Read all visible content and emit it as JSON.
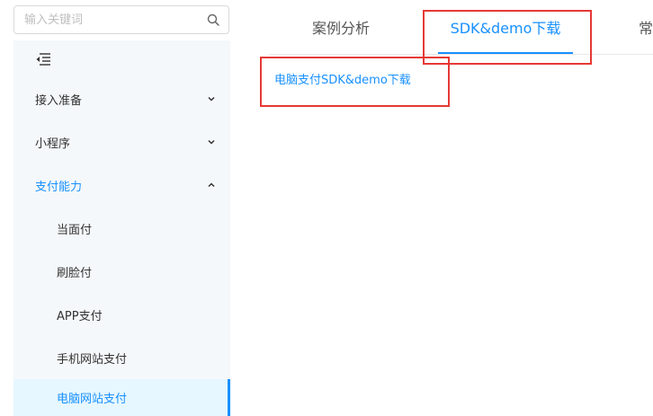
{
  "search": {
    "placeholder": "输入关键词",
    "value": "",
    "icon": "search-icon"
  },
  "sidebar": {
    "collapse_icon": "menu-fold-icon",
    "items": [
      {
        "label": "接入准备",
        "expanded": false
      },
      {
        "label": "小程序",
        "expanded": false
      },
      {
        "label": "支付能力",
        "expanded": true,
        "children": [
          {
            "label": "当面付"
          },
          {
            "label": "刷脸付"
          },
          {
            "label": "APP支付"
          },
          {
            "label": "手机网站支付"
          },
          {
            "label": "电脑网站支付",
            "selected": true
          }
        ]
      }
    ]
  },
  "tabs": [
    {
      "label": "案例分析"
    },
    {
      "label": "SDK&demo下载",
      "active": true
    },
    {
      "label": "常"
    }
  ],
  "content": {
    "link": "电脑支付SDK&demo下载"
  },
  "colors": {
    "accent": "#1890ff",
    "highlight": "#e53935",
    "sidebar_bg": "#f5f8fa",
    "active_bg": "#e6f7ff"
  }
}
